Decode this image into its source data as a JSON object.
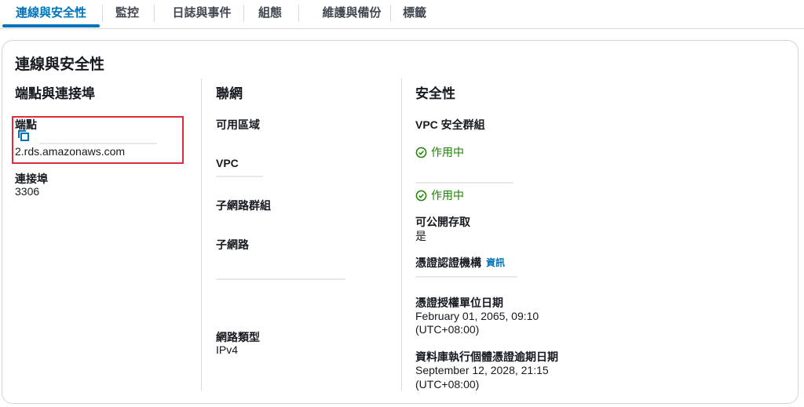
{
  "tabs": [
    {
      "label": "連線與安全性",
      "active": true
    },
    {
      "label": "監控"
    },
    {
      "label": "日誌與事件"
    },
    {
      "label": "組態"
    },
    {
      "label": "維護與備份"
    },
    {
      "label": "標籤"
    }
  ],
  "card": {
    "title": "連線與安全性",
    "endpoint_section": {
      "heading": "端點與連接埠",
      "endpoint_label": "端點",
      "endpoint_value": "2.rds.amazonaws.com",
      "port_label": "連接埠",
      "port_value": "3306"
    },
    "network_section": {
      "heading": "聯網",
      "az_label": "可用區域",
      "vpc_label": "VPC",
      "subnet_group_label": "子網路群組",
      "subnets_label": "子網路",
      "network_type_label": "網路類型",
      "network_type_value": "IPv4"
    },
    "security_section": {
      "heading": "安全性",
      "vpc_sg_label": "VPC 安全群組",
      "status_1": "作用中",
      "status_2": "作用中",
      "public_label": "可公開存取",
      "public_value": "是",
      "ca_label": "憑證認證機構",
      "ca_info_link": "資訊",
      "ca_date_label": "憑證授權單位日期",
      "ca_date_value": "February 01, 2065, 09:10",
      "ca_date_tz": "(UTC+08:00)",
      "db_cert_label": "資料庫執行個體憑證逾期日期",
      "db_cert_value": "September 12, 2028, 21:15",
      "db_cert_tz": "(UTC+08:00)"
    }
  },
  "colors": {
    "accent": "#0073bb",
    "success": "#1d8102",
    "highlight": "#e02b3c"
  }
}
